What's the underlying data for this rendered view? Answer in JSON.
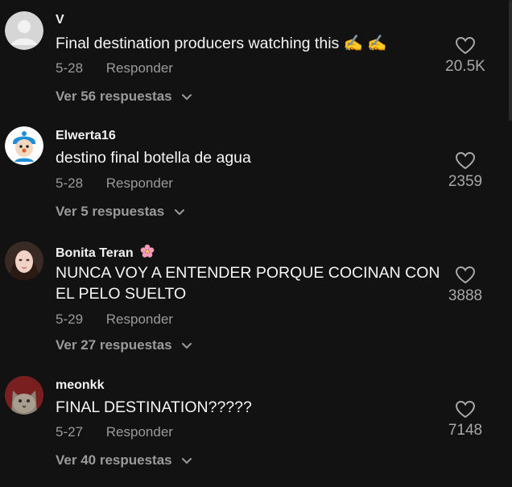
{
  "comments": [
    {
      "username": "V",
      "text": "Final destination producers watching this ✍️ ✍️",
      "date": "5-28",
      "reply_label": "Responder",
      "replies_label": "Ver 56 respuestas",
      "likes": "20.5K",
      "avatar": "default-gray-avatar"
    },
    {
      "username": "Elwerta16",
      "text": "destino final botella de agua",
      "date": "5-28",
      "reply_label": "Responder",
      "replies_label": "Ver 5 respuestas",
      "likes": "2359",
      "avatar": "cartoon-avatar"
    },
    {
      "username": "Bonita Teran",
      "text": "NUNCA VOY A ENTENDER PORQUE COCINAN CON EL PELO SUELTO",
      "date": "5-29",
      "reply_label": "Responder",
      "replies_label": "Ver 27 respuestas",
      "likes": "3888",
      "avatar": "portrait-avatar",
      "badge": "cherry-blossom-emoji"
    },
    {
      "username": "meonkk",
      "text": "FINAL DESTINATION?????",
      "date": "5-27",
      "reply_label": "Responder",
      "replies_label": "Ver 40 respuestas",
      "likes": "7148",
      "avatar": "cat-avatar"
    }
  ],
  "colors": {
    "background": "#121212",
    "secondary_text": "#9a9a9a",
    "primary_text": "#f5f5f5"
  }
}
